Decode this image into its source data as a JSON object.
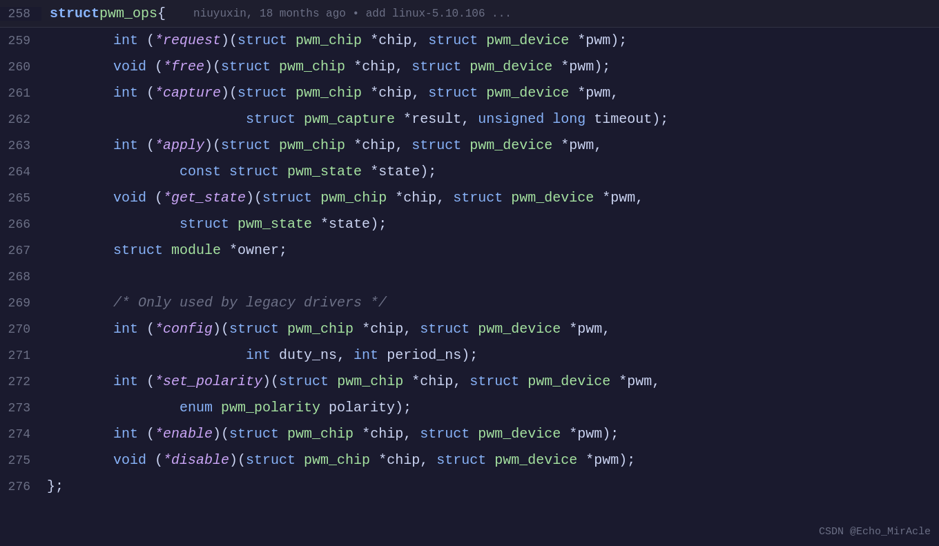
{
  "header": {
    "line_number": "258",
    "code": "struct pwm_ops {",
    "git_info": "niuyuxin, 18 months ago • add linux-5.10.106 ...",
    "watermark": "CSDN @Echo_MirAcle"
  },
  "lines": [
    {
      "number": "259",
      "tokens": [
        {
          "text": "        ",
          "class": ""
        },
        {
          "text": "int",
          "class": "kw-type"
        },
        {
          "text": " (",
          "class": "punct"
        },
        {
          "text": "*request",
          "class": "fn-name"
        },
        {
          "text": ")(",
          "class": "punct"
        },
        {
          "text": "struct",
          "class": "kw-struct"
        },
        {
          "text": " ",
          "class": ""
        },
        {
          "text": "pwm_chip",
          "class": "type-name"
        },
        {
          "text": " *chip, ",
          "class": "punct"
        },
        {
          "text": "struct",
          "class": "kw-struct"
        },
        {
          "text": " ",
          "class": ""
        },
        {
          "text": "pwm_device",
          "class": "type-name"
        },
        {
          "text": " *pwm);",
          "class": "punct"
        }
      ]
    },
    {
      "number": "260",
      "tokens": [
        {
          "text": "        ",
          "class": ""
        },
        {
          "text": "void",
          "class": "kw-type"
        },
        {
          "text": " (",
          "class": "punct"
        },
        {
          "text": "*free",
          "class": "fn-name"
        },
        {
          "text": ")(",
          "class": "punct"
        },
        {
          "text": "struct",
          "class": "kw-struct"
        },
        {
          "text": " ",
          "class": ""
        },
        {
          "text": "pwm_chip",
          "class": "type-name"
        },
        {
          "text": " *chip, ",
          "class": "punct"
        },
        {
          "text": "struct",
          "class": "kw-struct"
        },
        {
          "text": " ",
          "class": ""
        },
        {
          "text": "pwm_device",
          "class": "type-name"
        },
        {
          "text": " *pwm);",
          "class": "punct"
        }
      ]
    },
    {
      "number": "261",
      "tokens": [
        {
          "text": "        ",
          "class": ""
        },
        {
          "text": "int",
          "class": "kw-type"
        },
        {
          "text": " (",
          "class": "punct"
        },
        {
          "text": "*capture",
          "class": "fn-name"
        },
        {
          "text": ")(",
          "class": "punct"
        },
        {
          "text": "struct",
          "class": "kw-struct"
        },
        {
          "text": " ",
          "class": ""
        },
        {
          "text": "pwm_chip",
          "class": "type-name"
        },
        {
          "text": " *chip, ",
          "class": "punct"
        },
        {
          "text": "struct",
          "class": "kw-struct"
        },
        {
          "text": " ",
          "class": ""
        },
        {
          "text": "pwm_device",
          "class": "type-name"
        },
        {
          "text": " *",
          "class": "punct"
        },
        {
          "text": "pwm",
          "class": "var-name"
        },
        {
          "text": ",",
          "class": "punct"
        }
      ]
    },
    {
      "number": "262",
      "tokens": [
        {
          "text": "                        ",
          "class": ""
        },
        {
          "text": "struct",
          "class": "kw-struct"
        },
        {
          "text": " ",
          "class": ""
        },
        {
          "text": "pwm_capture",
          "class": "type-name"
        },
        {
          "text": " *",
          "class": "punct"
        },
        {
          "text": "result",
          "class": "var-name"
        },
        {
          "text": ", ",
          "class": "punct"
        },
        {
          "text": "unsigned",
          "class": "kw-type"
        },
        {
          "text": " ",
          "class": ""
        },
        {
          "text": "long",
          "class": "kw-type"
        },
        {
          "text": " ",
          "class": ""
        },
        {
          "text": "timeout",
          "class": "var-name"
        },
        {
          "text": ");",
          "class": "punct"
        }
      ]
    },
    {
      "number": "263",
      "tokens": [
        {
          "text": "        ",
          "class": ""
        },
        {
          "text": "int",
          "class": "kw-type"
        },
        {
          "text": " (",
          "class": "punct"
        },
        {
          "text": "*apply",
          "class": "fn-name"
        },
        {
          "text": ")(",
          "class": "punct"
        },
        {
          "text": "struct",
          "class": "kw-struct"
        },
        {
          "text": " ",
          "class": ""
        },
        {
          "text": "pwm_chip",
          "class": "type-name"
        },
        {
          "text": " *chip, ",
          "class": "punct"
        },
        {
          "text": "struct",
          "class": "kw-struct"
        },
        {
          "text": " ",
          "class": ""
        },
        {
          "text": "pwm_device",
          "class": "type-name"
        },
        {
          "text": " *",
          "class": "punct"
        },
        {
          "text": "pwm",
          "class": "var-name"
        },
        {
          "text": ",",
          "class": "punct"
        }
      ]
    },
    {
      "number": "264",
      "tokens": [
        {
          "text": "                ",
          "class": ""
        },
        {
          "text": "const",
          "class": "kw-type"
        },
        {
          "text": " ",
          "class": ""
        },
        {
          "text": "struct",
          "class": "kw-struct"
        },
        {
          "text": " ",
          "class": ""
        },
        {
          "text": "pwm_state",
          "class": "type-name"
        },
        {
          "text": " *",
          "class": "punct"
        },
        {
          "text": "state",
          "class": "var-name"
        },
        {
          "text": ");",
          "class": "punct"
        }
      ]
    },
    {
      "number": "265",
      "tokens": [
        {
          "text": "        ",
          "class": ""
        },
        {
          "text": "void",
          "class": "kw-type"
        },
        {
          "text": " (",
          "class": "punct"
        },
        {
          "text": "*get_state",
          "class": "fn-name"
        },
        {
          "text": ")(",
          "class": "punct"
        },
        {
          "text": "struct",
          "class": "kw-struct"
        },
        {
          "text": " ",
          "class": ""
        },
        {
          "text": "pwm_chip",
          "class": "type-name"
        },
        {
          "text": " *chip, ",
          "class": "punct"
        },
        {
          "text": "struct",
          "class": "kw-struct"
        },
        {
          "text": " ",
          "class": ""
        },
        {
          "text": "pwm_device",
          "class": "type-name"
        },
        {
          "text": " *",
          "class": "punct"
        },
        {
          "text": "pwm",
          "class": "var-name"
        },
        {
          "text": ",",
          "class": "punct"
        }
      ]
    },
    {
      "number": "266",
      "tokens": [
        {
          "text": "                ",
          "class": ""
        },
        {
          "text": "struct",
          "class": "kw-struct"
        },
        {
          "text": " ",
          "class": ""
        },
        {
          "text": "pwm_state",
          "class": "type-name"
        },
        {
          "text": " *",
          "class": "punct"
        },
        {
          "text": "state",
          "class": "var-name"
        },
        {
          "text": ");",
          "class": "punct"
        }
      ]
    },
    {
      "number": "267",
      "tokens": [
        {
          "text": "        ",
          "class": ""
        },
        {
          "text": "struct",
          "class": "kw-struct"
        },
        {
          "text": " ",
          "class": ""
        },
        {
          "text": "module",
          "class": "type-name"
        },
        {
          "text": " *",
          "class": "punct"
        },
        {
          "text": "owner",
          "class": "var-name"
        },
        {
          "text": ";",
          "class": "punct"
        }
      ]
    },
    {
      "number": "268",
      "tokens": []
    },
    {
      "number": "269",
      "tokens": [
        {
          "text": "        ",
          "class": ""
        },
        {
          "text": "/* Only used by legacy drivers */",
          "class": "comment"
        }
      ]
    },
    {
      "number": "270",
      "tokens": [
        {
          "text": "        ",
          "class": ""
        },
        {
          "text": "int",
          "class": "kw-type"
        },
        {
          "text": " (",
          "class": "punct"
        },
        {
          "text": "*config",
          "class": "fn-name"
        },
        {
          "text": ")(",
          "class": "punct"
        },
        {
          "text": "struct",
          "class": "kw-struct"
        },
        {
          "text": " ",
          "class": ""
        },
        {
          "text": "pwm_chip",
          "class": "type-name"
        },
        {
          "text": " *chip, ",
          "class": "punct"
        },
        {
          "text": "struct",
          "class": "kw-struct"
        },
        {
          "text": " ",
          "class": ""
        },
        {
          "text": "pwm_device",
          "class": "type-name"
        },
        {
          "text": " *",
          "class": "punct"
        },
        {
          "text": "pwm",
          "class": "var-name"
        },
        {
          "text": ",",
          "class": "punct"
        }
      ]
    },
    {
      "number": "271",
      "tokens": [
        {
          "text": "                        ",
          "class": ""
        },
        {
          "text": "int",
          "class": "kw-type"
        },
        {
          "text": " duty_ns, ",
          "class": "punct"
        },
        {
          "text": "int",
          "class": "kw-type"
        },
        {
          "text": " ",
          "class": ""
        },
        {
          "text": "period_ns",
          "class": "var-name"
        },
        {
          "text": ");",
          "class": "punct"
        }
      ]
    },
    {
      "number": "272",
      "tokens": [
        {
          "text": "        ",
          "class": ""
        },
        {
          "text": "int",
          "class": "kw-type"
        },
        {
          "text": " (",
          "class": "punct"
        },
        {
          "text": "*set_polarity",
          "class": "fn-name"
        },
        {
          "text": ")(",
          "class": "punct"
        },
        {
          "text": "struct",
          "class": "kw-struct"
        },
        {
          "text": " ",
          "class": ""
        },
        {
          "text": "pwm_chip",
          "class": "type-name"
        },
        {
          "text": " *chip, ",
          "class": "punct"
        },
        {
          "text": "struct",
          "class": "kw-struct"
        },
        {
          "text": " ",
          "class": ""
        },
        {
          "text": "pwm_device",
          "class": "type-name"
        },
        {
          "text": " *",
          "class": "punct"
        },
        {
          "text": "pwm",
          "class": "var-name"
        },
        {
          "text": ",",
          "class": "punct"
        }
      ]
    },
    {
      "number": "273",
      "tokens": [
        {
          "text": "                ",
          "class": ""
        },
        {
          "text": "enum",
          "class": "kw-type"
        },
        {
          "text": " ",
          "class": ""
        },
        {
          "text": "pwm_polarity",
          "class": "type-name"
        },
        {
          "text": " polarity);",
          "class": "punct"
        }
      ]
    },
    {
      "number": "274",
      "tokens": [
        {
          "text": "        ",
          "class": ""
        },
        {
          "text": "int",
          "class": "kw-type"
        },
        {
          "text": " (",
          "class": "punct"
        },
        {
          "text": "*enable",
          "class": "fn-name"
        },
        {
          "text": ")(",
          "class": "punct"
        },
        {
          "text": "struct",
          "class": "kw-struct"
        },
        {
          "text": " ",
          "class": ""
        },
        {
          "text": "pwm_chip",
          "class": "type-name"
        },
        {
          "text": " *chip, ",
          "class": "punct"
        },
        {
          "text": "struct",
          "class": "kw-struct"
        },
        {
          "text": " ",
          "class": ""
        },
        {
          "text": "pwm_device",
          "class": "type-name"
        },
        {
          "text": " *pwm);",
          "class": "punct"
        }
      ]
    },
    {
      "number": "275",
      "tokens": [
        {
          "text": "        ",
          "class": ""
        },
        {
          "text": "void",
          "class": "kw-type"
        },
        {
          "text": " (",
          "class": "punct"
        },
        {
          "text": "*disable",
          "class": "fn-name"
        },
        {
          "text": ")(",
          "class": "punct"
        },
        {
          "text": "struct",
          "class": "kw-struct"
        },
        {
          "text": " ",
          "class": ""
        },
        {
          "text": "pwm_chip",
          "class": "type-name"
        },
        {
          "text": " *chip, ",
          "class": "punct"
        },
        {
          "text": "struct",
          "class": "kw-struct"
        },
        {
          "text": " ",
          "class": ""
        },
        {
          "text": "pwm_device",
          "class": "type-name"
        },
        {
          "text": " *pwm);",
          "class": "punct"
        }
      ]
    },
    {
      "number": "276",
      "tokens": [
        {
          "text": "};",
          "class": "punct"
        }
      ]
    }
  ]
}
